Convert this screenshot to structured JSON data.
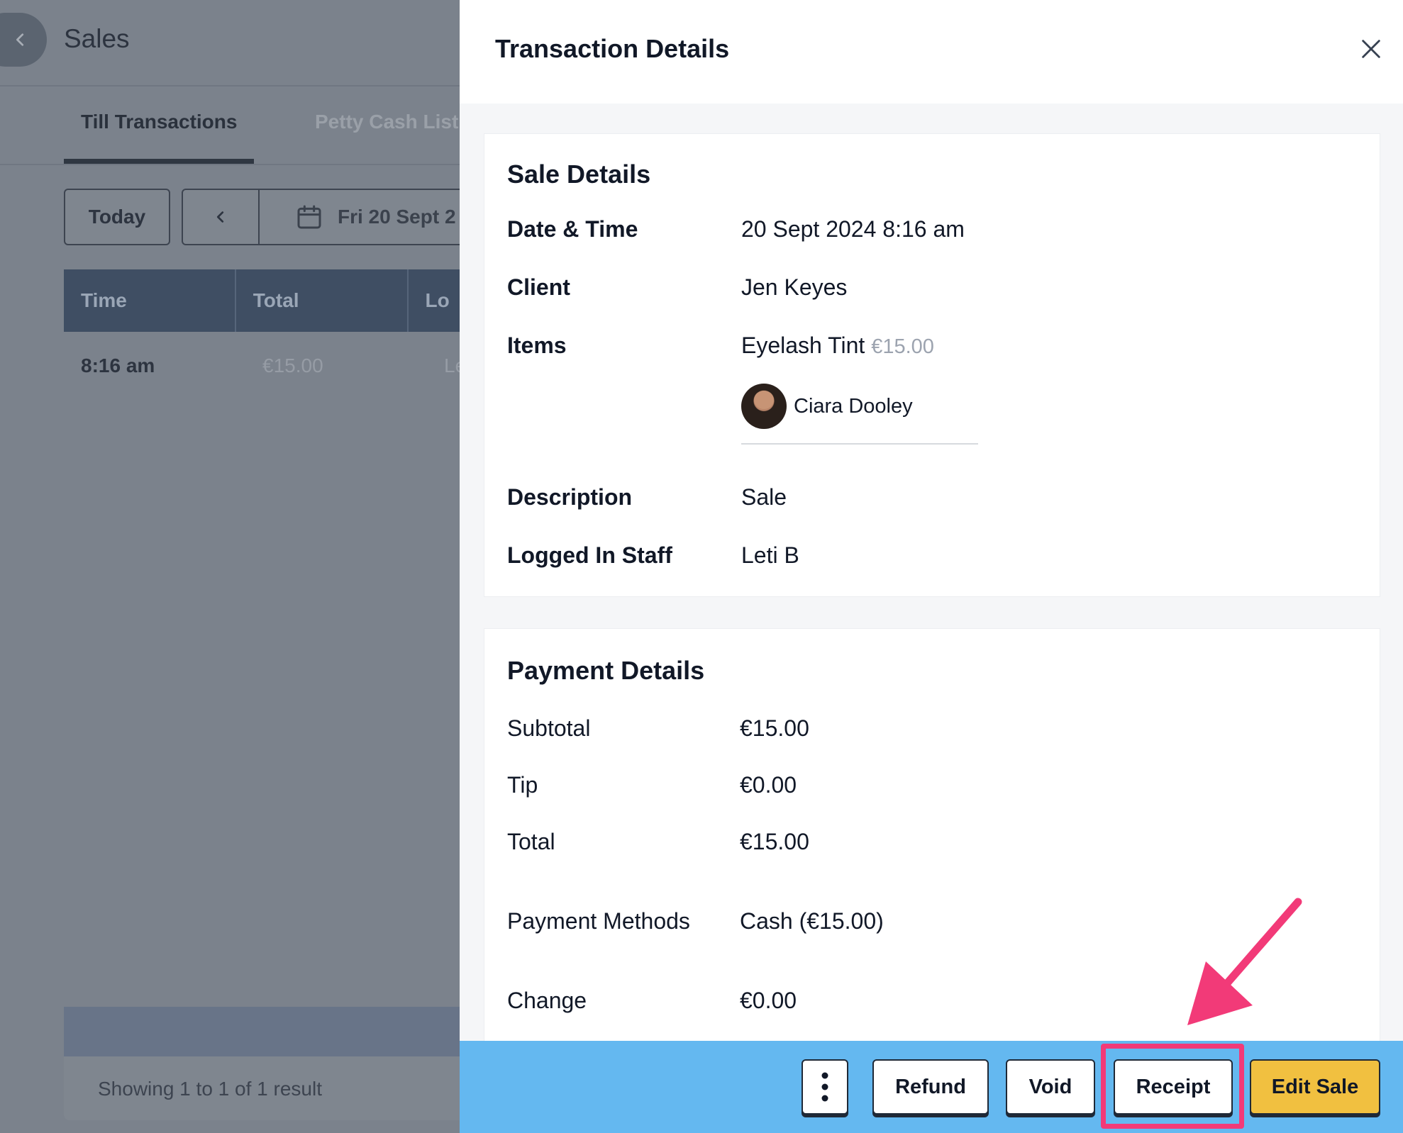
{
  "background": {
    "page_title": "Sales",
    "tabs": [
      {
        "label": "Till Transactions"
      },
      {
        "label": "Petty Cash List"
      }
    ],
    "today_label": "Today",
    "date_label": "Fri 20 Sept 2",
    "table": {
      "headers": [
        "Time",
        "Total",
        "Lo"
      ],
      "rows": [
        [
          "8:16 am",
          "€15.00",
          "Le"
        ]
      ]
    },
    "pagination_text": "Showing 1 to 1 of 1 result"
  },
  "panel": {
    "title": "Transaction Details",
    "sale_details": {
      "title": "Sale Details",
      "date_time_label": "Date & Time",
      "date_time_value": "20 Sept 2024 8:16 am",
      "client_label": "Client",
      "client_value": "Jen Keyes",
      "items_label": "Items",
      "item_name": "Eyelash Tint",
      "item_price": "€15.00",
      "item_staff": "Ciara Dooley",
      "description_label": "Description",
      "description_value": "Sale",
      "logged_staff_label": "Logged In Staff",
      "logged_staff_value": "Leti B"
    },
    "payment_details": {
      "title": "Payment Details",
      "subtotal_label": "Subtotal",
      "subtotal_value": "€15.00",
      "tip_label": "Tip",
      "tip_value": "€0.00",
      "total_label": "Total",
      "total_value": "€15.00",
      "methods_label": "Payment Methods",
      "methods_value": "Cash (€15.00)",
      "change_label": "Change",
      "change_value": "€0.00"
    }
  },
  "actions": {
    "refund": "Refund",
    "void": "Void",
    "receipt": "Receipt",
    "edit_sale": "Edit Sale"
  },
  "colors": {
    "action_bar": "#64b8f0",
    "edit_sale_button": "#f1c040",
    "highlight": "#f23a78",
    "table_header": "#3f4e63"
  },
  "icons": {
    "back": "chevron-left-icon",
    "prev_day": "chevron-left-icon",
    "calendar": "calendar-icon",
    "close": "close-icon",
    "more": "more-vertical-icon",
    "annotation": "arrow-icon"
  }
}
